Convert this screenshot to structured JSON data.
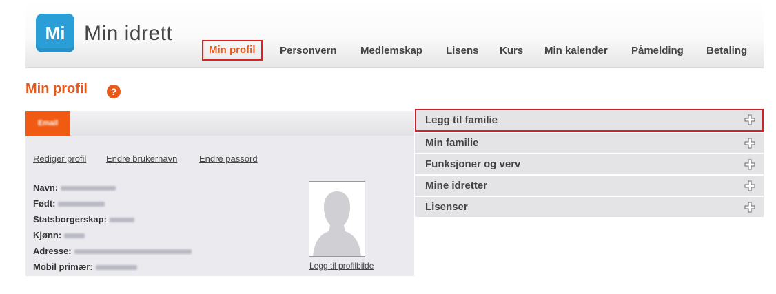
{
  "app": {
    "logo_badge": "Mi",
    "logo_text": "Min idrett",
    "brand_color": "#2b9ed8",
    "accent_color": "#e8591c"
  },
  "nav": {
    "items": [
      {
        "label": "Min profil",
        "active": true
      },
      {
        "label": "Personvern"
      },
      {
        "label": "Medlemskap"
      },
      {
        "label": "Lisens"
      },
      {
        "label": "Kurs"
      },
      {
        "label": "Min kalender"
      },
      {
        "label": "Påmelding"
      },
      {
        "label": "Betaling"
      }
    ]
  },
  "page": {
    "title": "Min profil",
    "help_icon": "?"
  },
  "profile": {
    "tab_label": "Email",
    "links": {
      "edit_profile": "Rediger profil",
      "change_username": "Endre brukernavn",
      "change_password": "Endre passord"
    },
    "fields": [
      {
        "label": "Navn:"
      },
      {
        "label": "Født:"
      },
      {
        "label": "Statsborgerskap:"
      },
      {
        "label": "Kjønn:"
      },
      {
        "label": "Adresse:"
      },
      {
        "label": "Mobil primær:"
      }
    ],
    "add_picture": "Legg til profilbilde"
  },
  "accordion": {
    "items": [
      {
        "label": "Legg til familie",
        "icon": "plus-icon",
        "highlighted": true
      },
      {
        "label": "Min familie",
        "icon": "plus-icon"
      },
      {
        "label": "Funksjoner og verv",
        "icon": "plus-icon"
      },
      {
        "label": "Mine idretter",
        "icon": "plus-icon"
      },
      {
        "label": "Lisenser",
        "icon": "plus-icon"
      }
    ]
  }
}
